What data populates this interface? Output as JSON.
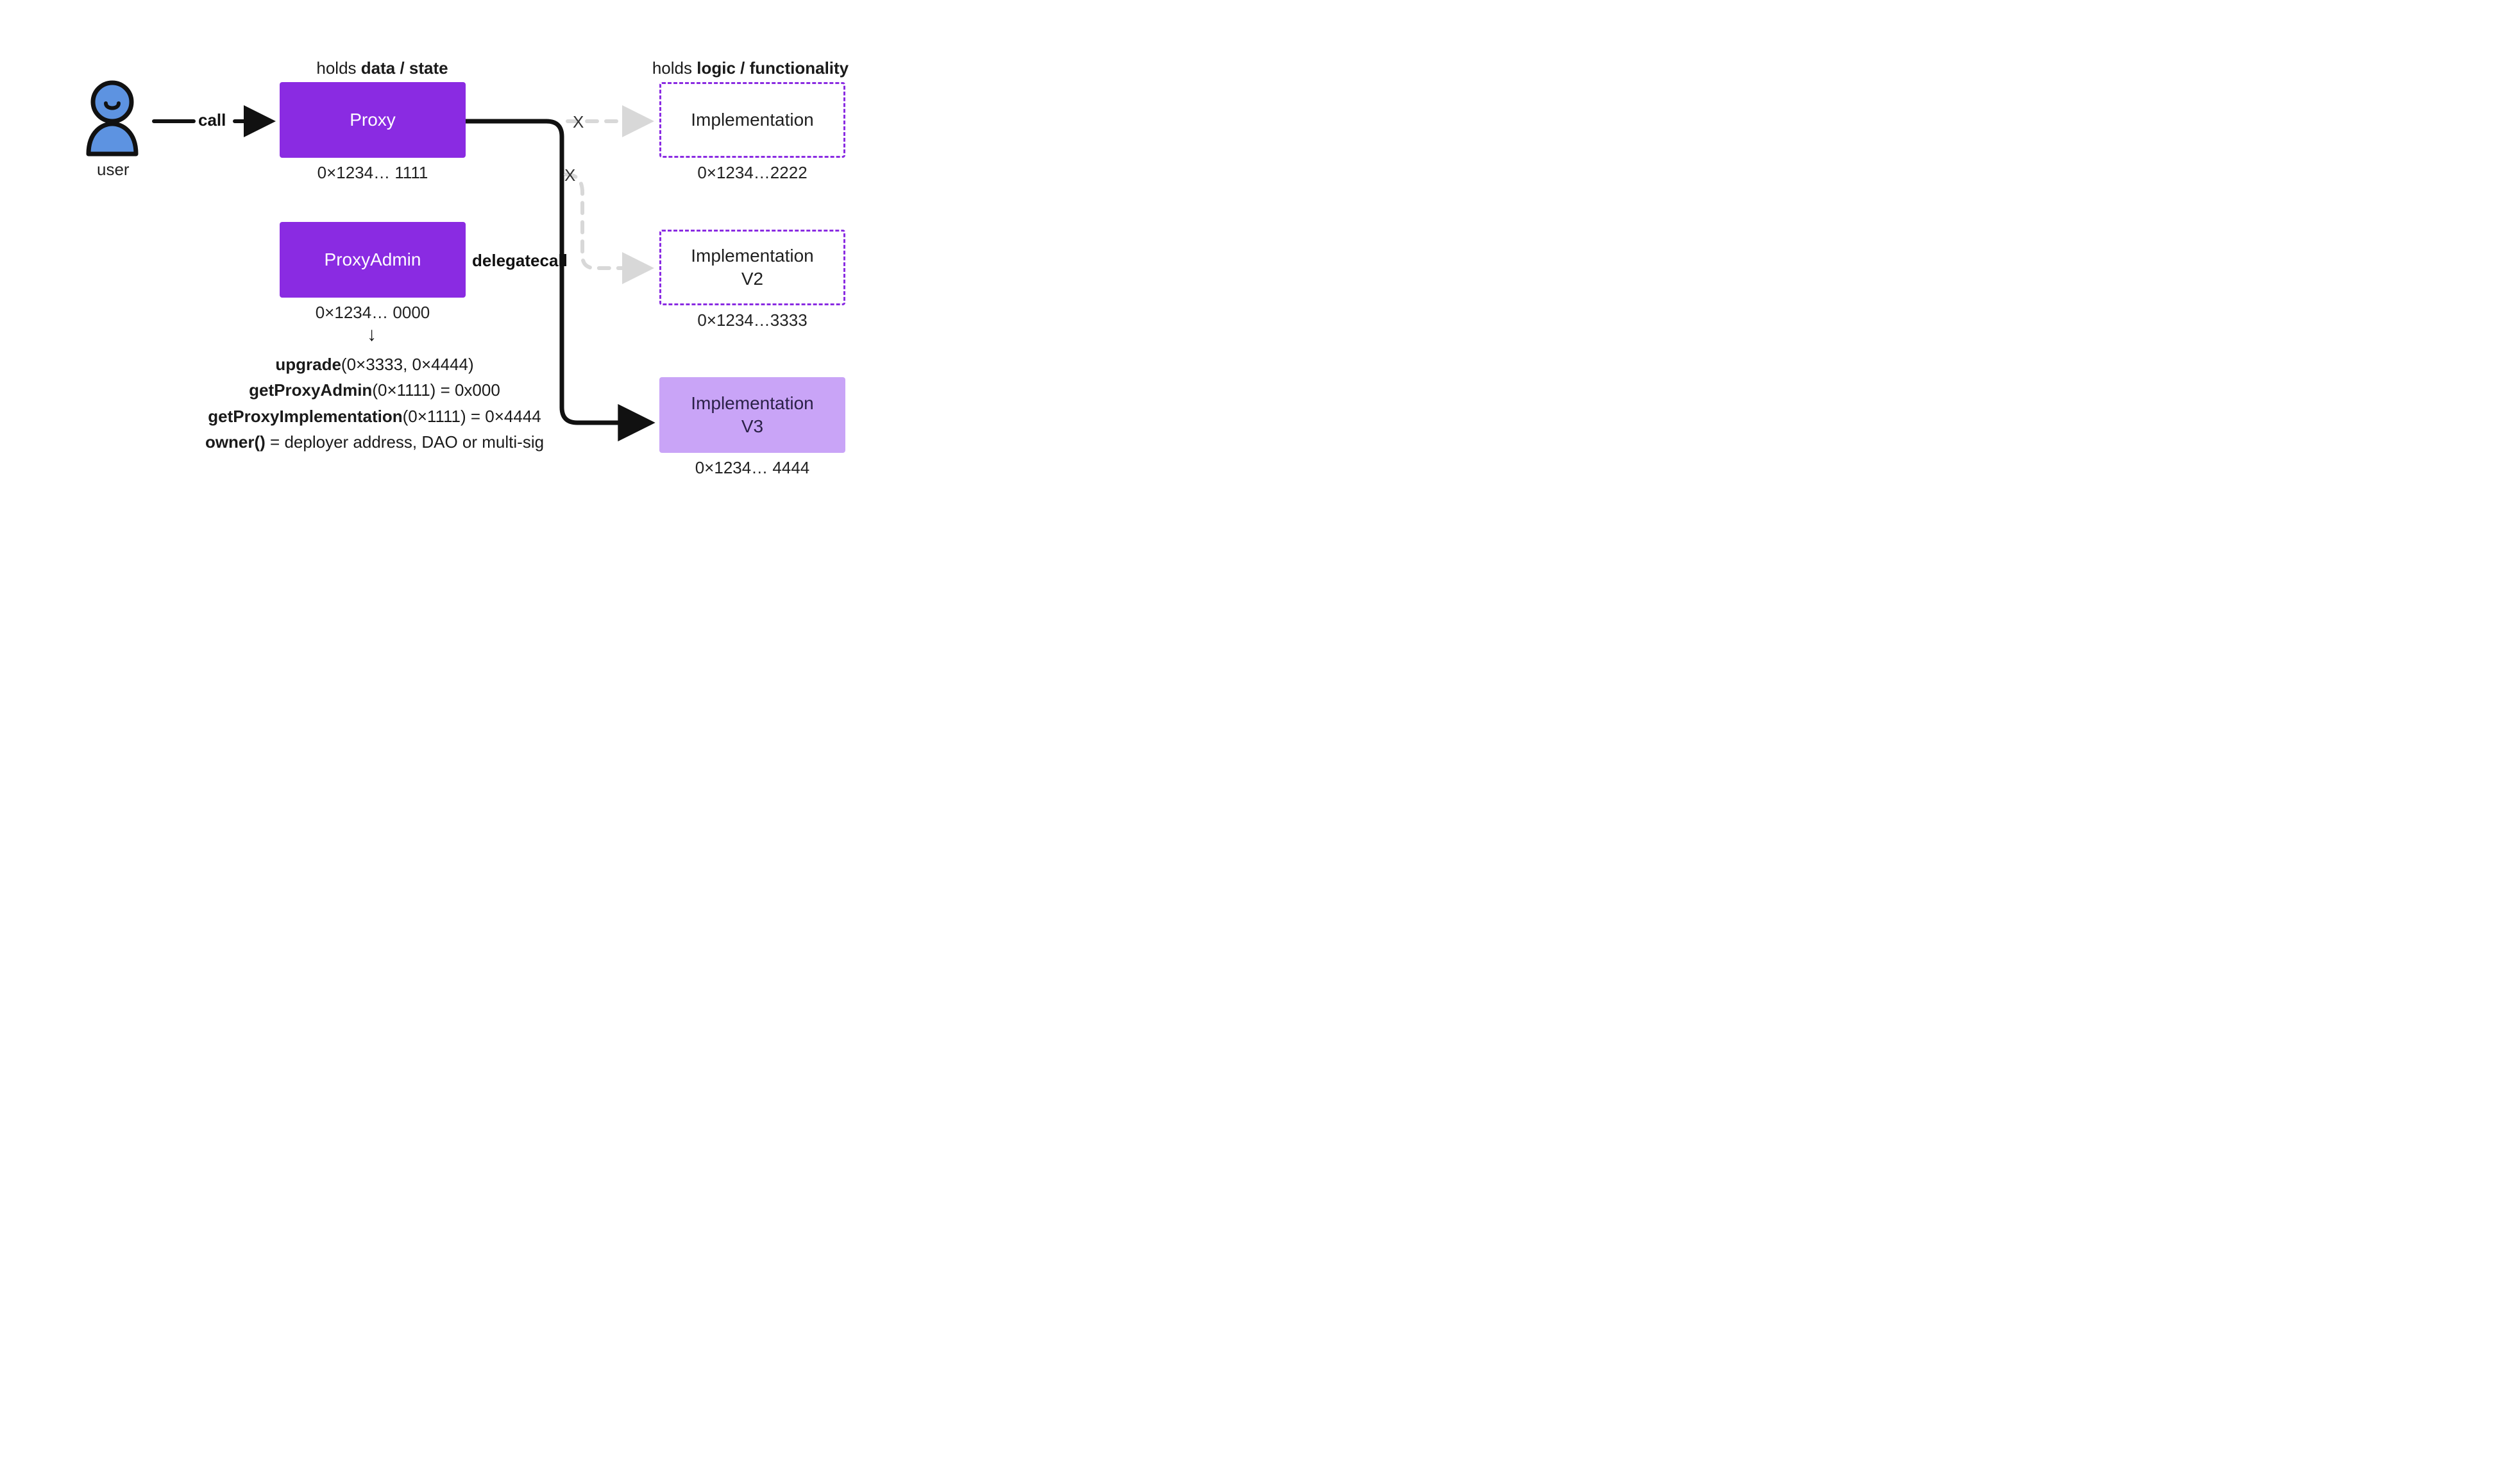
{
  "user": {
    "label": "user"
  },
  "edges": {
    "call_label": "call",
    "delegatecall_label": "delegatecall",
    "x1": "X",
    "x2": "X"
  },
  "proxy": {
    "caption_prefix": "holds ",
    "caption_bold": "data / state",
    "label": "Proxy",
    "addr": "0×1234… 1111"
  },
  "proxy_admin": {
    "label": "ProxyAdmin",
    "addr": "0×1234… 0000"
  },
  "impl_caption": {
    "prefix": "holds ",
    "bold": "logic / functionality"
  },
  "impl1": {
    "label": "Implementation",
    "addr": "0×1234…2222"
  },
  "impl2": {
    "label_line1": "Implementation",
    "label_line2": "V2",
    "addr": "0×1234…3333"
  },
  "impl3": {
    "label_line1": "Implementation",
    "label_line2": "V3",
    "addr": "0×1234… 4444"
  },
  "funcs": {
    "upgrade_b": "upgrade",
    "upgrade_args": "(0×3333, 0×4444)",
    "getProxyAdmin_b": "getProxyAdmin",
    "getProxyAdmin_args": "(0×1111) = 0x000",
    "getProxyImplementation_b": "getProxyImplementation",
    "getProxyImplementation_args": "(0×1111) = 0×4444",
    "owner_b": "owner()",
    "owner_args": " = deployer address, DAO or multi-sig"
  },
  "colors": {
    "purple": "#8a2be2",
    "light_purple": "#c9a4f7",
    "user_fill": "#5d93e1",
    "black": "#111111",
    "grey": "#d8d8d8"
  }
}
